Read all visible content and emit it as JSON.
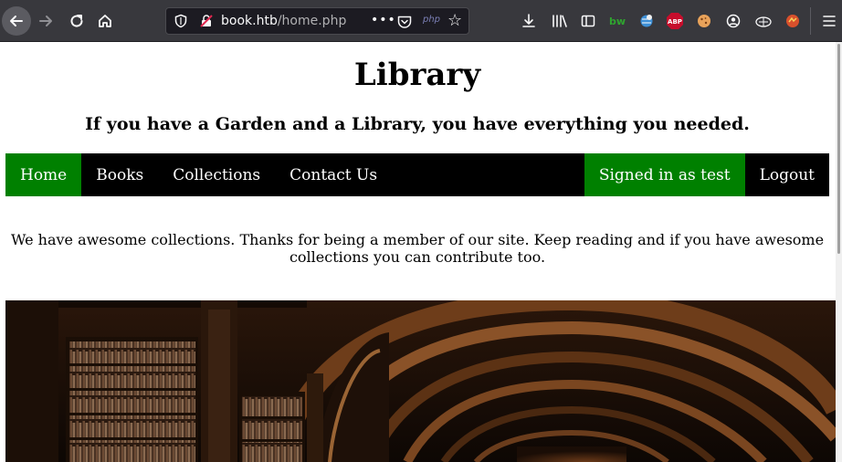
{
  "browser": {
    "url_host": "book.htb",
    "url_path": "/home.php",
    "url_more": "•••",
    "php_badge": "php",
    "abp_label": "ABP",
    "bw_label": "bw"
  },
  "page": {
    "title": "Library",
    "tagline": "If you have a Garden and a Library, you have everything you needed.",
    "intro": "We have awesome collections. Thanks for being a member of our site. Keep reading and if you have awesome collections you can contribute too."
  },
  "nav": {
    "home": "Home",
    "books": "Books",
    "collections": "Collections",
    "contact": "Contact Us",
    "signed_in": "Signed in as test",
    "logout": "Logout"
  },
  "colors": {
    "nav_background": "#000000",
    "nav_active": "#008000",
    "nav_text": "#ffffff"
  },
  "icons": {
    "back": "arrow-left-icon",
    "forward": "arrow-right-icon",
    "reload": "reload-icon",
    "home": "home-icon",
    "star": "star-icon",
    "menu": "hamburger-icon"
  }
}
